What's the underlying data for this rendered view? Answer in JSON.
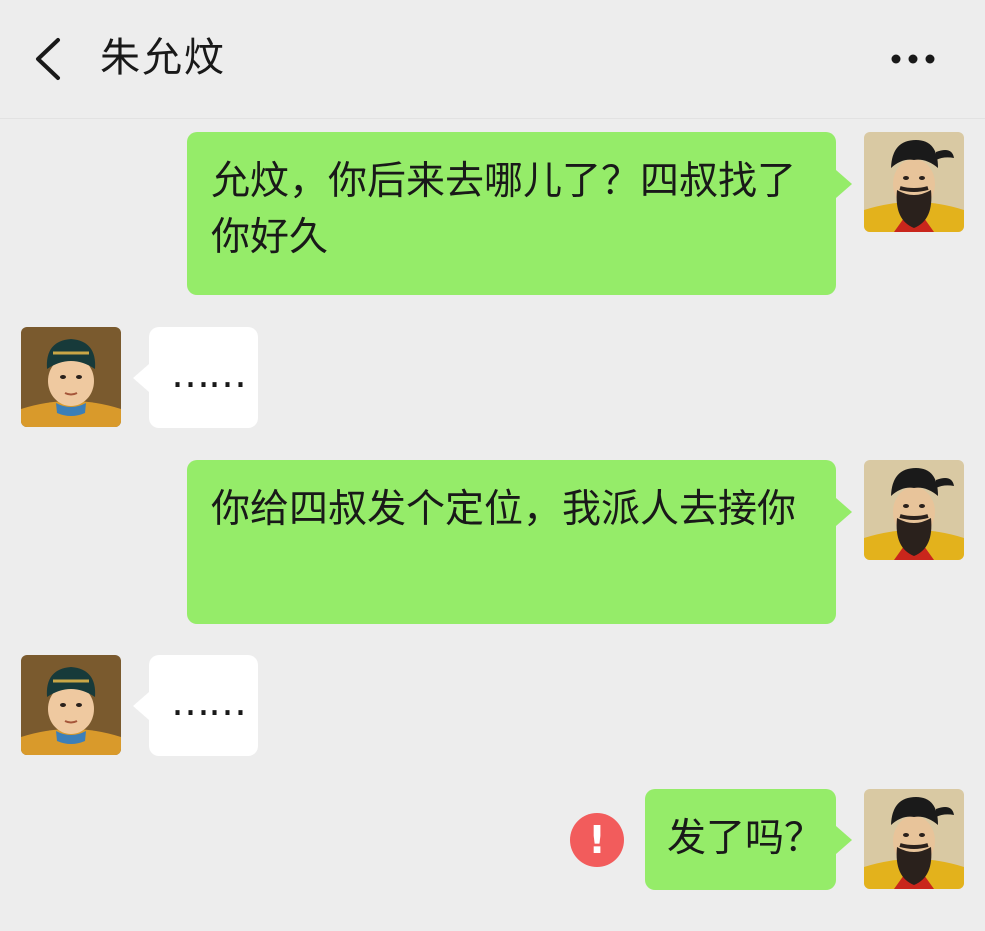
{
  "header": {
    "title": "朱允炆",
    "back_icon": "chevron-left-icon",
    "more_icon": "more-dots-icon"
  },
  "messages": [
    {
      "side": "right",
      "sender": "self",
      "text": "允炆，你后来去哪儿了？四叔找了你好久"
    },
    {
      "side": "left",
      "sender": "other",
      "text": "……"
    },
    {
      "side": "right",
      "sender": "self",
      "text": "你给四叔发个定位，我派人去接你"
    },
    {
      "side": "left",
      "sender": "other",
      "text": "……"
    },
    {
      "side": "right",
      "sender": "self",
      "text": "发了吗？",
      "status": "send-failed"
    }
  ],
  "error": {
    "symbol": "!"
  },
  "colors": {
    "background": "#ededed",
    "outgoing_bubble": "#95ec69",
    "incoming_bubble": "#ffffff",
    "error": "#f25c5c"
  }
}
